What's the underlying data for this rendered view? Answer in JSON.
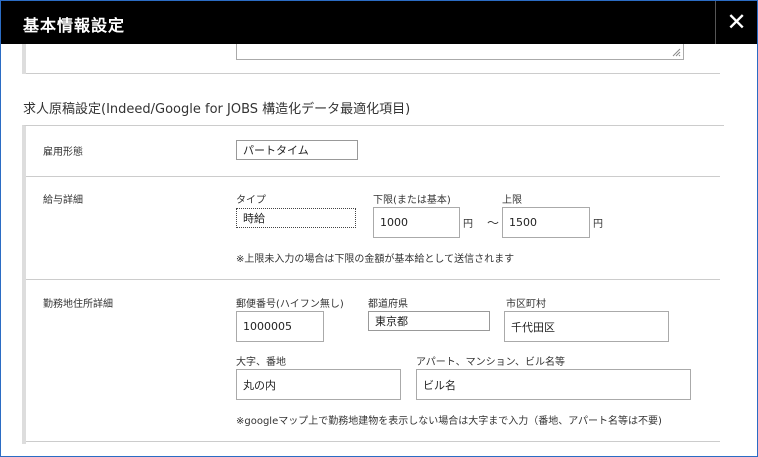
{
  "dialog": {
    "title": "基本情報設定",
    "close_label": "✕"
  },
  "section": {
    "heading": "求人原稿設定(Indeed/Google for JOBS 構造化データ最適化項目)"
  },
  "employment": {
    "label": "雇用形態",
    "value": "パートタイム"
  },
  "salary": {
    "label": "給与詳細",
    "type_caption": "タイプ",
    "type_value": "時給",
    "min_caption": "下限(または基本)",
    "min_value": "1000",
    "yen1": "円",
    "tilde": "〜",
    "max_caption": "上限",
    "max_value": "1500",
    "yen2": "円",
    "note": "※上限未入力の場合は下限の金額が基本給として送信されます"
  },
  "address": {
    "label": "勤務地住所詳細",
    "postal_caption": "郵便番号(ハイフン無し)",
    "postal_value": "1000005",
    "pref_caption": "都道府県",
    "pref_value": "東京都",
    "city_caption": "市区町村",
    "city_value": "千代田区",
    "street_caption": "大字、番地",
    "street_value": "丸の内",
    "building_caption": "アパート、マンション、ビル名等",
    "building_value": "ビル名",
    "note": "※googleマップ上で勤務地建物を表示しない場合は大字まで入力（番地、アパート名等は不要)"
  }
}
